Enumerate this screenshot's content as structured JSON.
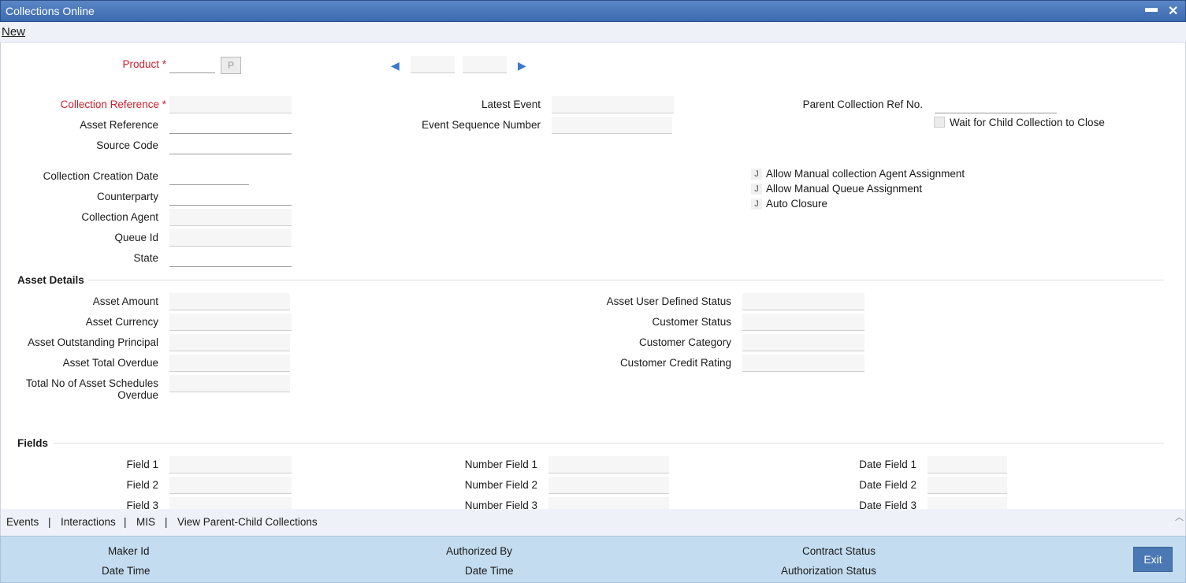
{
  "window": {
    "title": "Collections Online",
    "minimize_glyph": "▬",
    "close_glyph": "✕"
  },
  "menu": {
    "new_label": "New"
  },
  "header": {
    "product_label": "Product",
    "product_button": "P",
    "required_mark": "*",
    "collection_reference_label": "Collection Reference",
    "asset_reference_label": "Asset Reference",
    "source_code_label": "Source Code",
    "latest_event_label": "Latest Event",
    "event_sequence_label": "Event Sequence Number",
    "parent_ref_label": "Parent Collection Ref No.",
    "wait_child_label": "Wait for Child Collection to Close",
    "creation_date_label": "Collection Creation Date",
    "counterparty_label": "Counterparty",
    "collection_agent_label": "Collection Agent",
    "queue_id_label": "Queue Id",
    "state_label": "State",
    "allow_manual_agent_label": "Allow Manual collection Agent Assignment",
    "allow_manual_queue_label": "Allow Manual Queue Assignment",
    "auto_closure_label": "Auto Closure",
    "checkbox_glyph": "J"
  },
  "asset_details": {
    "section_title": "Asset Details",
    "asset_amount_label": "Asset Amount",
    "asset_currency_label": "Asset Currency",
    "asset_outstanding_label": "Asset Outstanding Principal",
    "asset_total_overdue_label": "Asset Total Overdue",
    "total_schedules_line1": "Total No of Asset Schedules",
    "total_schedules_line2": "Overdue",
    "user_defined_status_label": "Asset User Defined Status",
    "customer_status_label": "Customer Status",
    "customer_category_label": "Customer Category",
    "customer_credit_label": "Customer Credit Rating"
  },
  "fields": {
    "section_title": "Fields",
    "field1": "Field 1",
    "field2": "Field 2",
    "field3": "Field 3",
    "number_field1": "Number Field 1",
    "number_field2": "Number Field 2",
    "number_field3": "Number Field 3",
    "date_field1": "Date Field 1",
    "date_field2": "Date Field 2",
    "date_field3": "Date Field 3"
  },
  "tabs": {
    "events": "Events",
    "interactions": "Interactions",
    "mis": "MIS",
    "view_parent_child": "View Parent-Child Collections",
    "separator": "|",
    "scroll_up_glyph": "︿"
  },
  "footer": {
    "maker_id_label": "Maker Id",
    "maker_date_label": "Date Time",
    "authorized_by_label": "Authorized By",
    "auth_date_label": "Date Time",
    "contract_status_label": "Contract Status",
    "authorization_status_label": "Authorization Status",
    "exit_label": "Exit"
  }
}
